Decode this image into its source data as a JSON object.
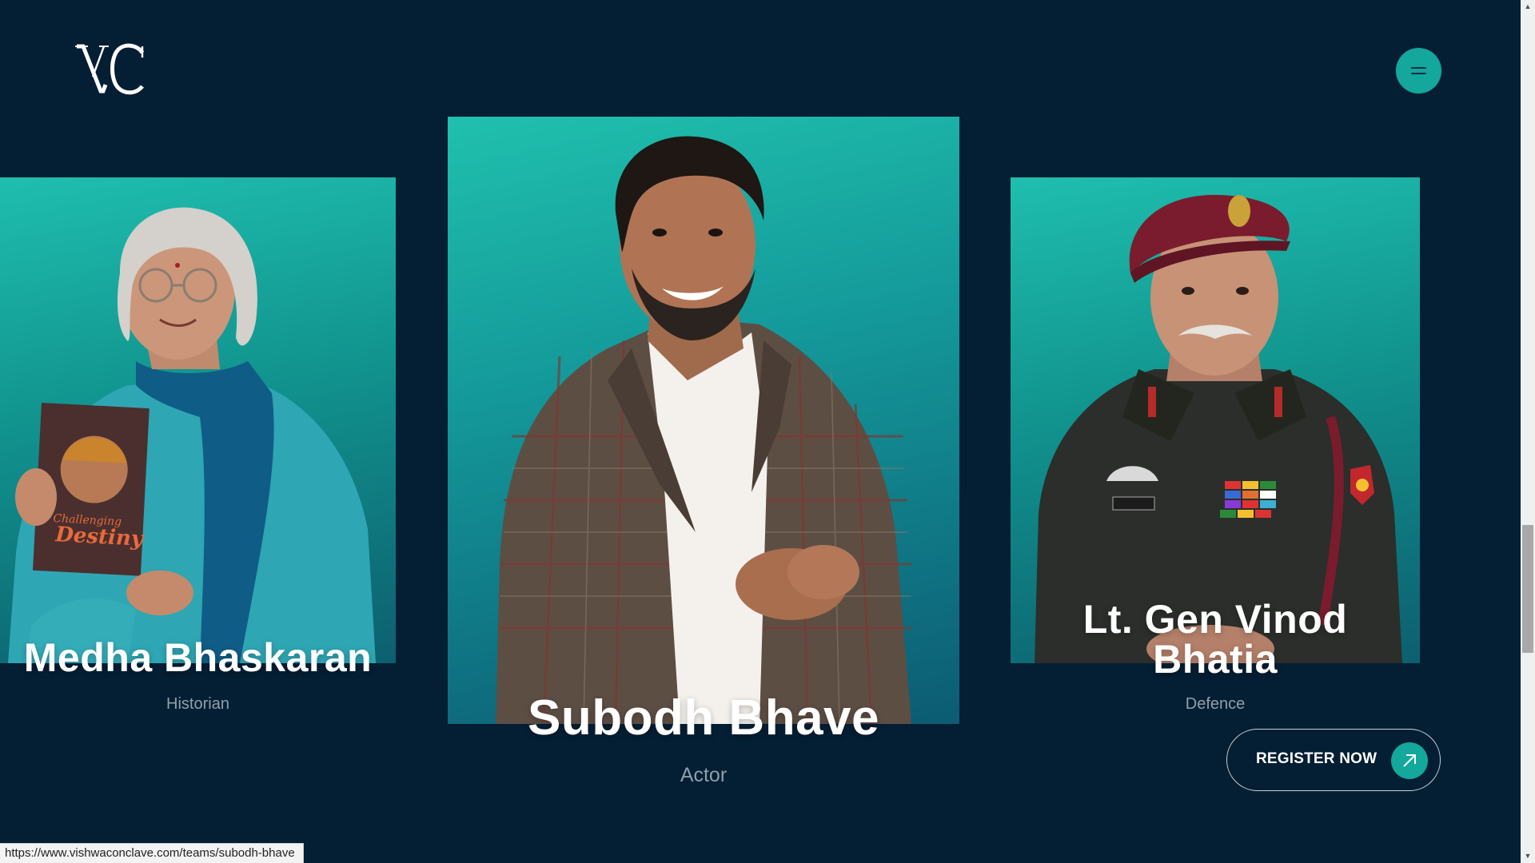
{
  "header": {
    "logo_text": "VC"
  },
  "menu": {
    "icon": "hamburger-menu-icon"
  },
  "speakers": [
    {
      "name": "Medha Bhaskaran",
      "role": "Historian",
      "book_title": "Challenging Destiny"
    },
    {
      "name": "Subodh Bhave",
      "role": "Actor"
    },
    {
      "name": "Lt. Gen Vinod Bhatia",
      "role": "Defence"
    }
  ],
  "cta": {
    "register_label": "REGISTER NOW",
    "arrow_icon": "arrow-up-right-icon"
  },
  "status_bar": {
    "url": "https://www.vishwaconclave.com/teams/subodh-bhave"
  },
  "colors": {
    "background": "#041e33",
    "accent": "#14a79c",
    "card_gradient_top": "#1fbeae",
    "card_gradient_bottom": "#0d5f6f"
  }
}
